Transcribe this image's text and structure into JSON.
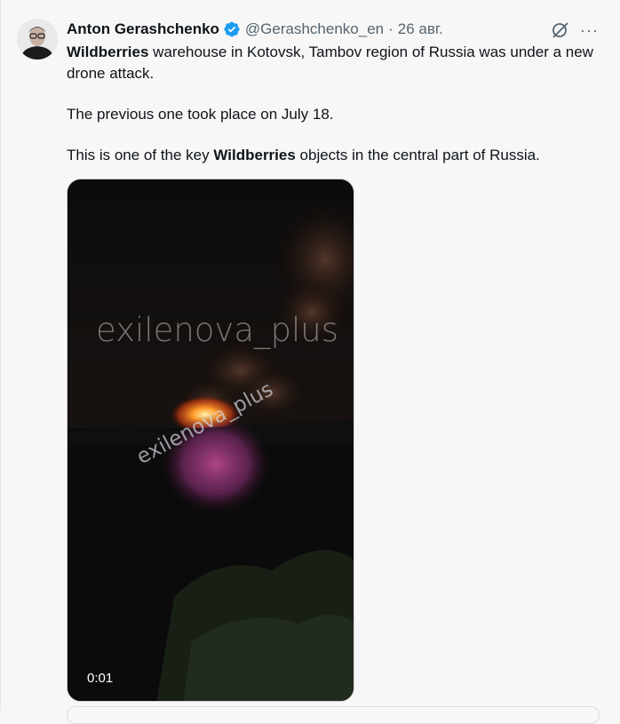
{
  "author": {
    "name": "Anton Gerashchenko",
    "handle": "@Gerashchenko_en",
    "separator": "·",
    "date": "26 авг.",
    "verified": true,
    "verified_color": "#1d9bf0"
  },
  "actions": {
    "grok_icon": "grok-icon",
    "more_label": "···"
  },
  "tweet": {
    "line1_bold": "Wildberries",
    "line1_rest": " warehouse in Kotovsk, Tambov region of Russia was under a new drone attack.",
    "line2": "The previous one took place on July 18.",
    "line3_pre": "This is one of the key ",
    "line3_bold": "Wildberries",
    "line3_post": " objects in the central part of Russia."
  },
  "media": {
    "watermark_large": "exilenova_plus",
    "watermark_small": "exilenova_plus",
    "timestamp": "0:01"
  }
}
